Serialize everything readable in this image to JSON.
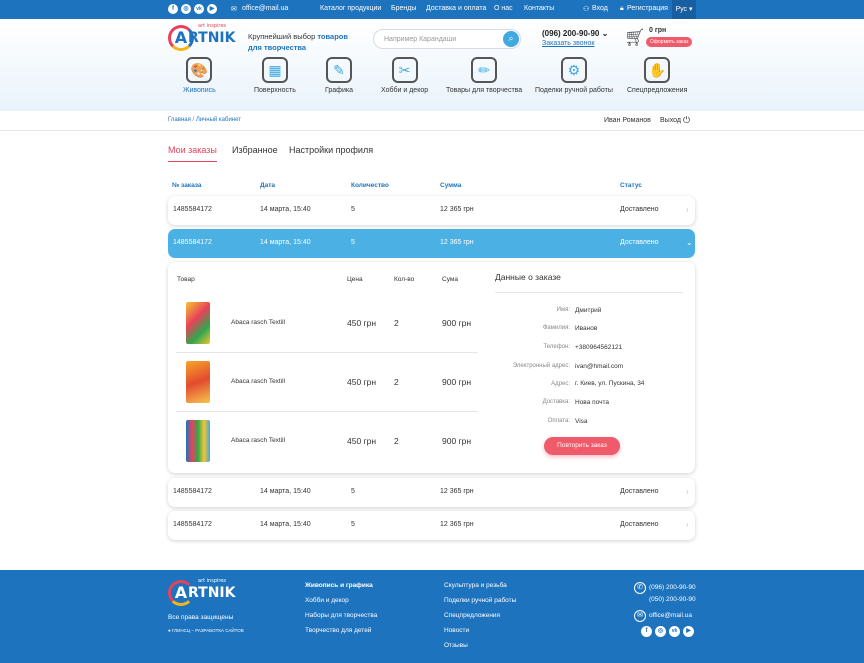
{
  "topbar": {
    "email": "office@mail.ua",
    "nav": [
      "Каталог продукции",
      "Бренды",
      "Доставка и оплата",
      "О нас",
      "Контакты"
    ],
    "login": "Вход",
    "register": "Регистрация",
    "lang": "Рус ▾",
    "social": [
      "f",
      "◎",
      "vk",
      "▶"
    ]
  },
  "header": {
    "logo_word": "RTNIK",
    "logo_letter": "A",
    "logo_tagline": "art inspires",
    "tagline_plain": "Крупнейший выбор ",
    "tagline_bold1": "товаров",
    "tagline_bold2": "для творчества",
    "search_placeholder": "Например Карандаши",
    "phone": "(096) 200-90-90",
    "callback": "Заказать звонок",
    "cart_sum": "0 грн",
    "cart_button": "Оформить заказ"
  },
  "categories": [
    {
      "label": "Живопись",
      "icon": "🎨"
    },
    {
      "label": "Поверхность",
      "icon": "▦"
    },
    {
      "label": "Графика",
      "icon": "✎"
    },
    {
      "label": "Хобби и декор",
      "icon": "✂"
    },
    {
      "label": "Товары для творчества",
      "icon": "✏"
    },
    {
      "label": "Поделки ручной работы",
      "icon": "⚙"
    },
    {
      "label": "Спецпредложения",
      "icon": "✋"
    }
  ],
  "breadcrumb": {
    "home": "Главная",
    "sep": "/",
    "current": "Личный кабинет"
  },
  "user": {
    "name": "Иван Романов",
    "exit": "Выход"
  },
  "tabs": [
    "Мои заказы",
    "Избранное",
    "Настройки профиля"
  ],
  "orders": {
    "headers": [
      "№ заказа",
      "Дата",
      "Количество",
      "Сумма",
      "Статус"
    ],
    "rows": [
      {
        "id": "1485584172",
        "date": "14 марта, 15:40",
        "qty": "5",
        "sum": "12 365 грн",
        "status": "Доставлено"
      },
      {
        "id": "1485584172",
        "date": "14 марта, 15:40",
        "qty": "5",
        "sum": "12 365 грн",
        "status": "Доставлено"
      },
      {
        "id": "1485584172",
        "date": "14 марта, 15:40",
        "qty": "5",
        "sum": "12 365 грн",
        "status": "Доставлено"
      },
      {
        "id": "1485584172",
        "date": "14 марта, 15:40",
        "qty": "5",
        "sum": "12 365 грн",
        "status": "Доставлено"
      }
    ]
  },
  "detail": {
    "headers": [
      "Товар",
      "Цена",
      "Кол-во",
      "Сума"
    ],
    "products": [
      {
        "name": "Abaca rasch Textill",
        "price": "450 грн",
        "qty": "2",
        "sum": "900 грн"
      },
      {
        "name": "Abaca rasch Textill",
        "price": "450 грн",
        "qty": "2",
        "sum": "900 грн"
      },
      {
        "name": "Abaca rasch Textill",
        "price": "450 грн",
        "qty": "2",
        "sum": "900 грн"
      }
    ],
    "info_title": "Данные о заказе",
    "fields": [
      {
        "label": "Имя:",
        "value": "Дмитрий"
      },
      {
        "label": "Фамилия:",
        "value": "Иванов"
      },
      {
        "label": "Телефон:",
        "value": "+380964562121"
      },
      {
        "label": "Электронный адрес:",
        "value": "ivan@hmail.com"
      },
      {
        "label": "Адрес:",
        "value": "г. Киев, ул. Пускина, 34"
      },
      {
        "label": "Доставка:",
        "value": "Нова почта"
      },
      {
        "label": "Оплата:",
        "value": "Visa"
      }
    ],
    "repeat": "Повторить заказ"
  },
  "footer": {
    "rights": "Все права защищены",
    "dev": "ГЛИНСЦ – РАЗРАБОТКА САЙТОВ",
    "col1": [
      "Живопись и графика",
      "Хобби и декор",
      "Наборы для творчества",
      "Творчество для детей"
    ],
    "col2": [
      "Скульптура и резьба",
      "Поделки ручной работы",
      "Спецпредложения",
      "Новости",
      "Отзывы"
    ],
    "phones": [
      "(096) 200-90-90",
      "(050) 200-90-90"
    ],
    "email": "office@mail.ua"
  }
}
